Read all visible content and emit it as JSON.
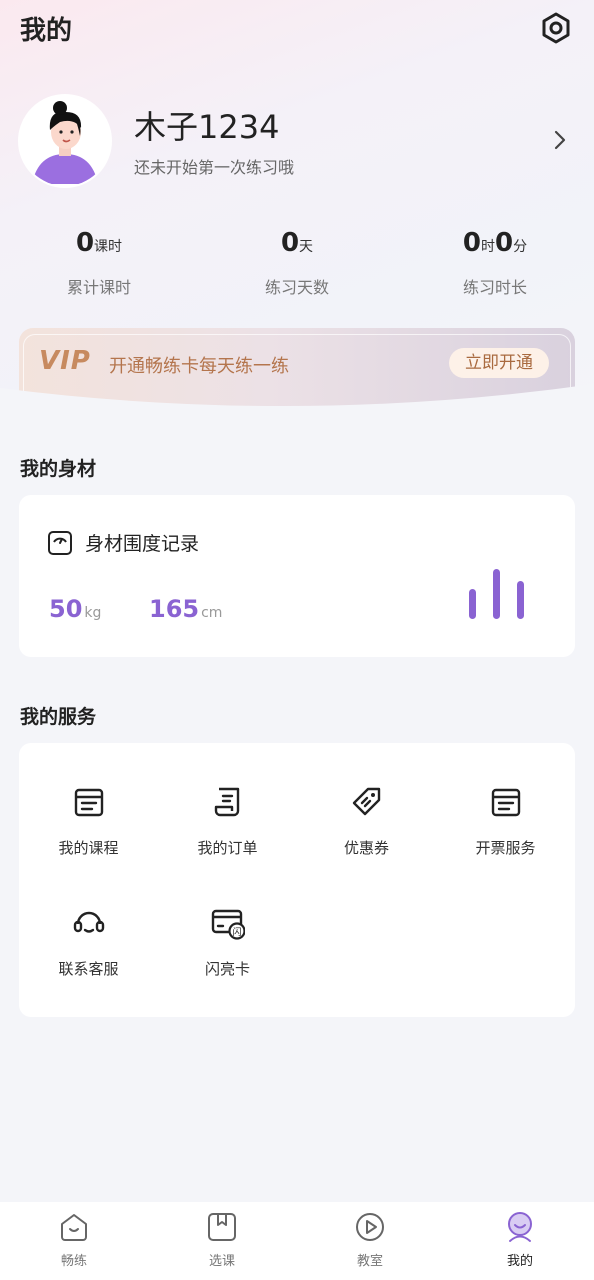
{
  "header": {
    "title": "我的"
  },
  "profile": {
    "name": "木子1234",
    "subtitle": "还未开始第一次练习哦"
  },
  "stats": [
    {
      "value": "0",
      "unit": "课时",
      "label": "累计课时"
    },
    {
      "value1": "0",
      "unit1": "天",
      "label": "练习天数"
    },
    {
      "hours": "0",
      "hours_unit": "时",
      "minutes": "0",
      "minutes_unit": "分",
      "label": "练习时长"
    }
  ],
  "vip": {
    "logo": "VIP",
    "text": "开通畅练卡每天练一练",
    "button": "立即开通"
  },
  "body_section": {
    "title": "我的身材",
    "card_title": "身材围度记录",
    "weight": "50",
    "weight_unit": "kg",
    "height": "165",
    "height_unit": "cm"
  },
  "services_section": {
    "title": "我的服务",
    "items": [
      {
        "label": "我的课程",
        "icon": "course-icon"
      },
      {
        "label": "我的订单",
        "icon": "order-icon"
      },
      {
        "label": "优惠券",
        "icon": "coupon-icon"
      },
      {
        "label": "开票服务",
        "icon": "invoice-icon"
      },
      {
        "label": "联系客服",
        "icon": "headset-icon"
      },
      {
        "label": "闪亮卡",
        "icon": "flash-card-icon"
      }
    ]
  },
  "tabbar": {
    "items": [
      {
        "label": "畅练",
        "icon": "practice-icon",
        "active": false
      },
      {
        "label": "选课",
        "icon": "select-course-icon",
        "active": false
      },
      {
        "label": "教室",
        "icon": "classroom-icon",
        "active": false
      },
      {
        "label": "我的",
        "icon": "profile-icon",
        "active": true
      }
    ]
  },
  "colors": {
    "accent": "#8a63d2",
    "vip_gold": "#c78a5f",
    "background": "#f4f5f9"
  }
}
